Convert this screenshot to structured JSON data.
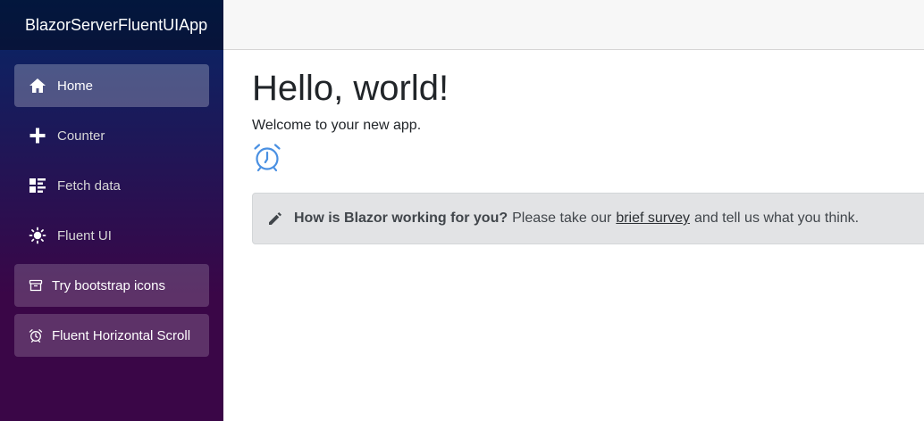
{
  "sidebar": {
    "brand": "BlazorServerFluentUIApp",
    "items": [
      {
        "label": "Home",
        "icon": "home-icon"
      },
      {
        "label": "Counter",
        "icon": "plus-icon"
      },
      {
        "label": "Fetch data",
        "icon": "list-rich-icon"
      },
      {
        "label": "Fluent UI",
        "icon": "sun-icon"
      },
      {
        "label": "Try bootstrap icons",
        "icon": "archive-icon"
      },
      {
        "label": "Fluent Horizontal Scroll",
        "icon": "alarm-icon"
      }
    ]
  },
  "main": {
    "title": "Hello, world!",
    "welcome": "Welcome to your new app.",
    "survey": {
      "question": "How is Blazor working for you?",
      "text_before": "Please take our",
      "link": "brief survey",
      "text_after": "and tell us what you think."
    }
  },
  "colors": {
    "sidebar_top": "#052767",
    "sidebar_bottom": "#3a0647",
    "alert_bg": "#e2e3e5",
    "icon_blue": "#4a90e2"
  }
}
